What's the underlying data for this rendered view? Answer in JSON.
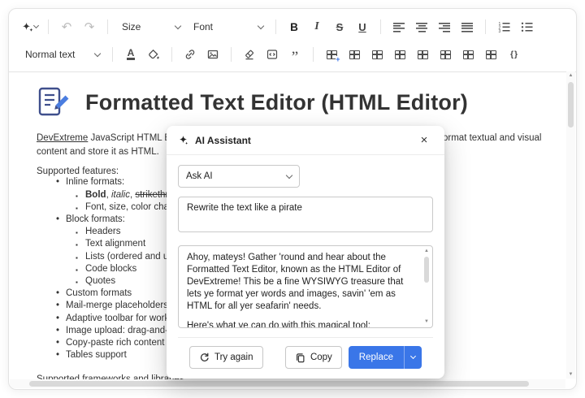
{
  "accent": "#3a76e8",
  "toolbar": {
    "size_label": "Size",
    "font_label": "Font",
    "paragraph_label": "Normal text"
  },
  "icons": {
    "undo": "↶",
    "redo": "↷",
    "bold": "B",
    "italic": "I",
    "strikethrough": "S",
    "underline": "U",
    "blockquote": "”",
    "cell_properties": "{ }",
    "table_plus": "+",
    "font_color": "A",
    "close": "×",
    "scroll_up": "▲",
    "scroll_down": "▼"
  },
  "editor": {
    "title": "Formatted Text Editor (HTML Editor)",
    "intro_link": "DevExtreme",
    "intro_rest": " JavaScript HTML Editor is a client-side WYSIWYG text editor that allows its users to format textual and visual content and store it as HTML.",
    "features_label": "Supported features:",
    "list": [
      {
        "t": "Inline formats:"
      },
      {
        "bold": "Bold",
        "sep1": ", ",
        "italic": "italic",
        "sep2": ", ",
        "strike": "strikethrough"
      },
      {
        "t": "Font, size, color changes"
      },
      {
        "t": "Block formats:"
      },
      {
        "t": "Headers"
      },
      {
        "t": "Text alignment"
      },
      {
        "t": "Lists (ordered and unordered)"
      },
      {
        "t": "Code blocks"
      },
      {
        "t": "Quotes"
      },
      {
        "t": "Custom formats"
      },
      {
        "t": "Mail-merge placeholders (for example, %username%)"
      },
      {
        "t": "Adaptive toolbar for working with the control on mobile devices"
      },
      {
        "t": "Image upload: drag-and-drop images to convert them to base64"
      },
      {
        "t": "Copy-paste rich content (unsupported formats are removed)"
      },
      {
        "t": "Tables support"
      }
    ],
    "footer_line": "Supported frameworks and libraries"
  },
  "dialog": {
    "title": "AI Assistant",
    "command_value": "Ask AI",
    "prompt_value": "Rewrite the text like a pirate",
    "output_p1": "Ahoy, mateys! Gather 'round and hear about the Formatted Text Editor, known as the HTML Editor of DevExtreme! This be a fine WYSIWYG treasure that lets ye format yer words and images, savin' 'em as HTML for all yer seafarin' needs.",
    "output_p2": "Here's what ye can do with this magical tool:",
    "try_again_label": "Try again",
    "copy_label": "Copy",
    "replace_label": "Replace"
  }
}
